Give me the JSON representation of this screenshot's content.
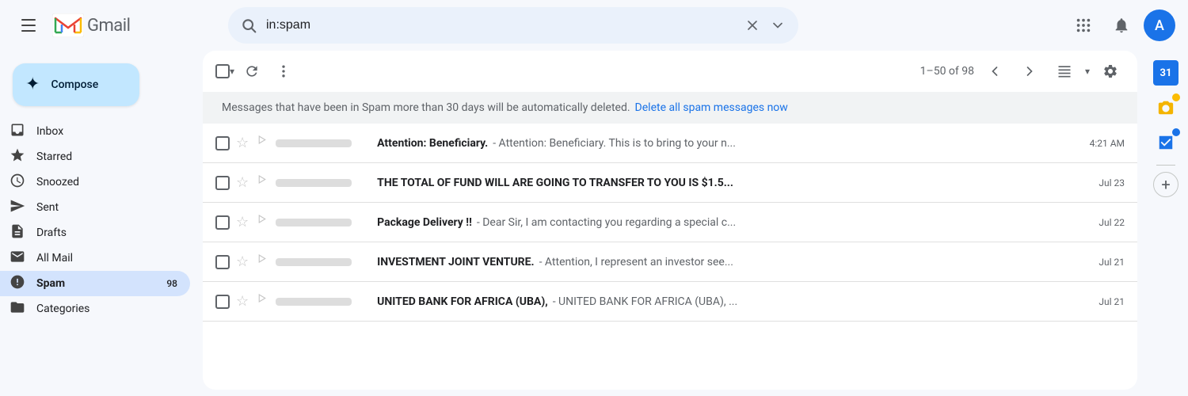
{
  "topbar": {
    "search_placeholder": "in:spam",
    "gmail_label": "Gmail"
  },
  "sidebar": {
    "compose_label": "Compose",
    "nav_items": [
      {
        "id": "inbox",
        "label": "Inbox",
        "icon": "☐",
        "badge": ""
      },
      {
        "id": "starred",
        "label": "Starred",
        "icon": "★",
        "badge": ""
      },
      {
        "id": "snoozed",
        "label": "Snoozed",
        "icon": "⏰",
        "badge": ""
      },
      {
        "id": "sent",
        "label": "Sent",
        "icon": "➤",
        "badge": ""
      },
      {
        "id": "drafts",
        "label": "Drafts",
        "icon": "📄",
        "badge": ""
      },
      {
        "id": "all-mail",
        "label": "All Mail",
        "icon": "✉",
        "badge": ""
      },
      {
        "id": "spam",
        "label": "Spam",
        "icon": "!",
        "badge": "98"
      },
      {
        "id": "categories",
        "label": "Categories",
        "icon": "▶",
        "badge": ""
      }
    ]
  },
  "toolbar": {
    "pagination": "1–50 of 98"
  },
  "spam_notice": {
    "text": "Messages that have been in Spam more than 30 days will be automatically deleted.",
    "link_text": "Delete all spam messages now"
  },
  "emails": [
    {
      "subject": "Attention: Beneficiary.",
      "snippet": "- Attention: Beneficiary. This is to bring to your n...",
      "time": "4:21 AM"
    },
    {
      "subject": "THE TOTAL OF FUND WILL ARE GOING TO TRANSFER TO YOU IS $1.5...",
      "snippet": "",
      "time": "Jul 23"
    },
    {
      "subject": "Package Delivery !!",
      "snippet": "- Dear Sir, I am contacting you regarding a special c...",
      "time": "Jul 22"
    },
    {
      "subject": "INVESTMENT JOINT VENTURE.",
      "snippet": "- Attention, I represent an investor see...",
      "time": "Jul 21"
    },
    {
      "subject": "UNITED BANK FOR AFRICA (UBA),",
      "snippet": "- UNITED BANK FOR AFRICA (UBA), ...",
      "time": "Jul 21"
    }
  ]
}
